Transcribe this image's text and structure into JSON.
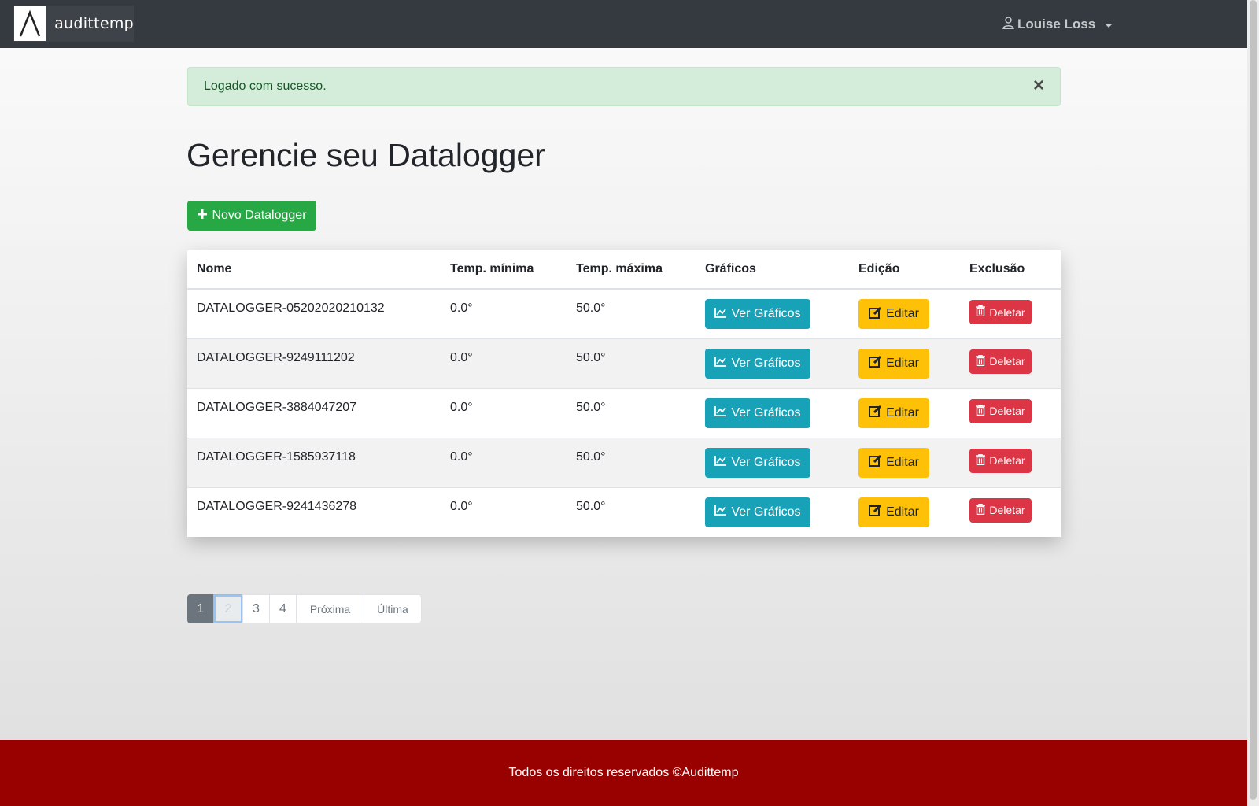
{
  "navbar": {
    "brand_name": "audittemp",
    "user_name": "Louise Loss"
  },
  "alert": {
    "message": "Logado com sucesso.",
    "close_symbol": "×"
  },
  "page": {
    "title": "Gerencie seu Datalogger",
    "new_button_label": "Novo Datalogger"
  },
  "table": {
    "headers": [
      "Nome",
      "Temp. mínima",
      "Temp. máxima",
      "Gráficos",
      "Edição",
      "Exclusão"
    ],
    "rows": [
      {
        "name": "DATALOGGER-05202020210132",
        "min": "0.0°",
        "max": "50.0°"
      },
      {
        "name": "DATALOGGER-9249111202",
        "min": "0.0°",
        "max": "50.0°"
      },
      {
        "name": "DATALOGGER-3884047207",
        "min": "0.0°",
        "max": "50.0°"
      },
      {
        "name": "DATALOGGER-1585937118",
        "min": "0.0°",
        "max": "50.0°"
      },
      {
        "name": "DATALOGGER-9241436278",
        "min": "0.0°",
        "max": "50.0°"
      }
    ],
    "charts_label": "Ver Gráficos",
    "edit_label": "Editar",
    "delete_label": "Deletar"
  },
  "pagination": {
    "pages": [
      "1",
      "2",
      "3",
      "4"
    ],
    "active_page": "1",
    "next_label": "Próxima",
    "last_label": "Última"
  },
  "footer": {
    "text": "Todos os direitos reservados ©Audittemp"
  },
  "colors": {
    "navbar": "#343a40",
    "success": "#28a745",
    "info": "#17a2b8",
    "warning": "#ffc107",
    "danger": "#dc3545",
    "footer": "#990000"
  },
  "icons": {
    "user": "user-icon",
    "plus": "plus-icon",
    "chart": "line-chart-icon",
    "edit": "edit-icon",
    "trash": "trash-icon"
  }
}
